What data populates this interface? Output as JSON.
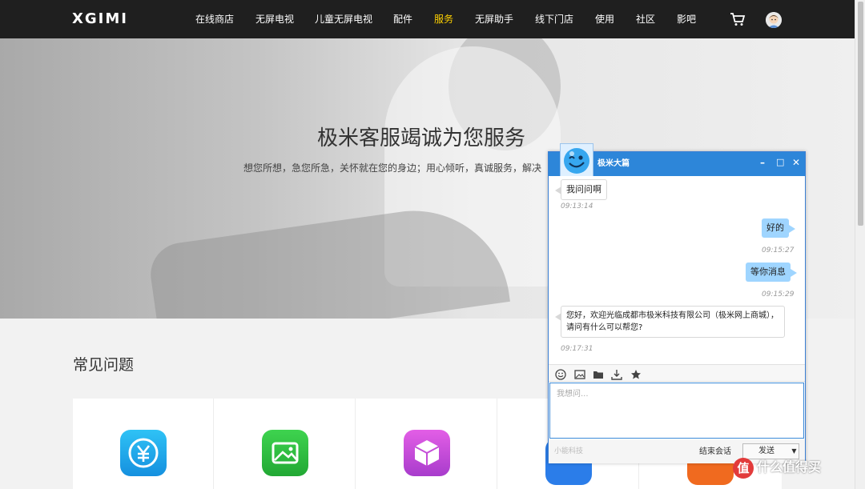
{
  "nav": {
    "logo": "XGIMI",
    "items": [
      {
        "label": "在线商店"
      },
      {
        "label": "无屏电视"
      },
      {
        "label": "儿童无屏电视"
      },
      {
        "label": "配件"
      },
      {
        "label": "服务",
        "active": true
      },
      {
        "label": "无屏助手"
      },
      {
        "label": "线下门店"
      },
      {
        "label": "使用"
      },
      {
        "label": "社区"
      },
      {
        "label": "影吧"
      }
    ],
    "cart_icon": "cart-icon",
    "avatar_icon": "user-avatar-icon",
    "active_color": "#ffd200"
  },
  "hero": {
    "title": "极米客服竭诚为您服务",
    "subtitle": "想您所想，急您所急，关怀就在您的身边；用心倾听，真诚服务，解决"
  },
  "faq": {
    "title": "常见问题",
    "cards": [
      {
        "icon": "yuan-coin-icon",
        "color": "#1aa6e8"
      },
      {
        "icon": "image-icon",
        "color": "#2bbd3e"
      },
      {
        "icon": "box-icon",
        "color": "#c54ed8"
      },
      {
        "icon": "blue-app-icon",
        "color": "#2b7de9"
      },
      {
        "icon": "orange-app-icon",
        "color": "#f06a1f"
      }
    ]
  },
  "chat": {
    "title": "极米大篇",
    "controls": {
      "minimize": "–",
      "maximize": "□",
      "close": "✕"
    },
    "messages": [
      {
        "side": "left",
        "text": "我问问啊",
        "time": "09:13:14"
      },
      {
        "side": "right",
        "text": "好的",
        "time": "09:15:27"
      },
      {
        "side": "right",
        "text": "等你消息",
        "time": "09:15:29"
      },
      {
        "side": "left",
        "text": "您好，欢迎光临成都市极米科技有限公司（极米网上商城），请问有什么可以帮您?",
        "time": "09:17:31"
      }
    ],
    "toolbar": [
      "smiley-icon",
      "image-icon",
      "folder-icon",
      "download-icon",
      "star-icon"
    ],
    "input_placeholder": "我想问...",
    "brand": "小能科技",
    "end_label": "结束会话",
    "send_label": "发送",
    "send_dropdown": "▼",
    "header_color": "#2d86d9"
  },
  "watermark": {
    "logo": "值",
    "text": "什么值得买"
  }
}
